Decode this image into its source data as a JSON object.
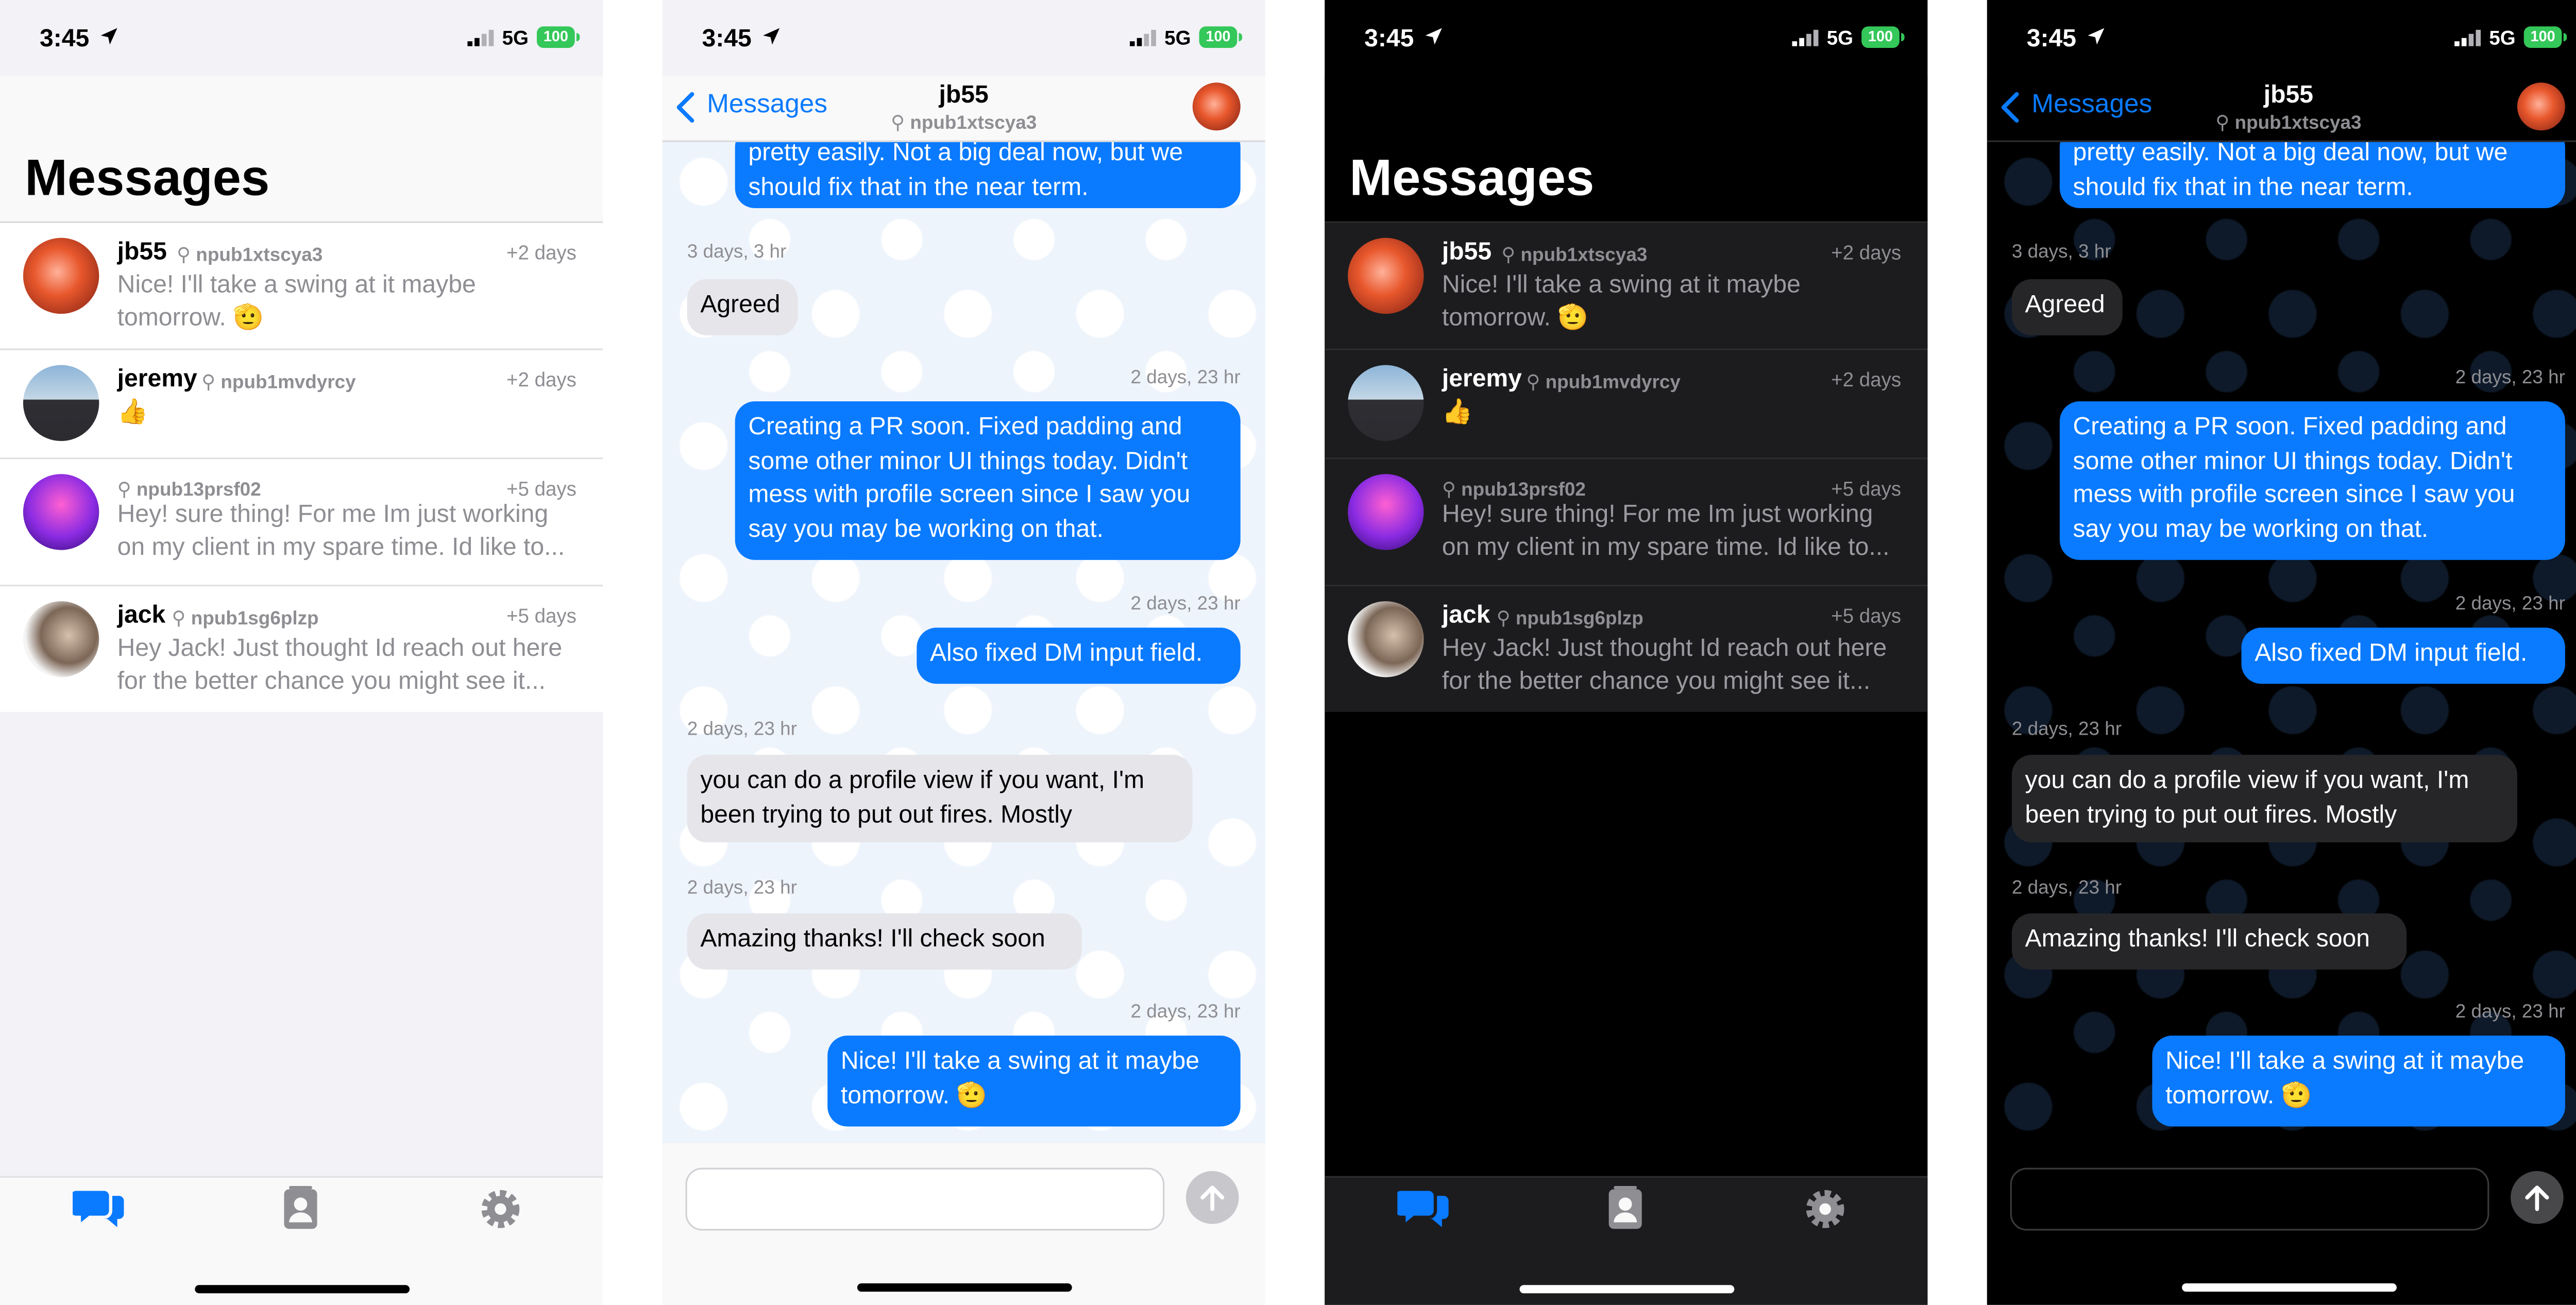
{
  "status": {
    "time": "3:45",
    "network": "5G",
    "battery": "100"
  },
  "colors": {
    "accent": "#0a7aff",
    "battery_green": "#34c759",
    "light_bg": "#f2f2f7",
    "dark_bg": "#000000"
  },
  "list_screen": {
    "title": "Messages",
    "conversations": [
      {
        "name": "jb55",
        "key": "npub1xtscya3",
        "time": "+2 days",
        "preview": "Nice! I'll take a swing at it maybe tomorrow. 🫡",
        "avatar": "avatar-jb55"
      },
      {
        "name": "jeremy",
        "key": "npub1mvdyrcy",
        "time": "+2 days",
        "preview": "👍",
        "avatar": "avatar-jeremy"
      },
      {
        "name": "",
        "key": "npub13prsf02",
        "time": "+5 days",
        "preview": "Hey! sure thing! For me Im just working on my client in my spare time. Id like to...",
        "avatar": "avatar-npub13prsf02"
      },
      {
        "name": "jack",
        "key": "npub1sg6plzp",
        "time": "+5 days",
        "preview": "Hey Jack! Just thought Id reach out here for the better chance you might see  it...",
        "avatar": "avatar-jack"
      }
    ]
  },
  "tabs": [
    "messages-icon",
    "contacts-icon",
    "settings-gear-icon"
  ],
  "chat_screen": {
    "back_label": "Messages",
    "contact_name": "jb55",
    "contact_key": "npub1xtscya3",
    "messages": [
      {
        "side": "out",
        "timestamp": "",
        "text": "pretty easily. Not a big deal now, but we should fix that in the near term."
      },
      {
        "side": "in",
        "timestamp": "3 days, 3 hr",
        "text": "Agreed"
      },
      {
        "side": "out",
        "timestamp": "2 days, 23 hr",
        "text": "Creating a PR soon. Fixed padding and some other minor UI things today. Didn't mess with profile screen since I saw you say you may be working on that."
      },
      {
        "side": "out",
        "timestamp": "2 days, 23 hr",
        "text": "Also fixed DM input field."
      },
      {
        "side": "in",
        "timestamp": "2 days, 23 hr",
        "text": "you can do a profile view if you want, I'm been trying to put out fires. Mostly"
      },
      {
        "side": "in",
        "timestamp": "2 days, 23 hr",
        "text": "Amazing thanks! I'll check soon"
      },
      {
        "side": "out",
        "timestamp": "2 days, 23 hr",
        "text": "Nice! I'll take a swing at it maybe tomorrow. 🫡"
      }
    ]
  }
}
